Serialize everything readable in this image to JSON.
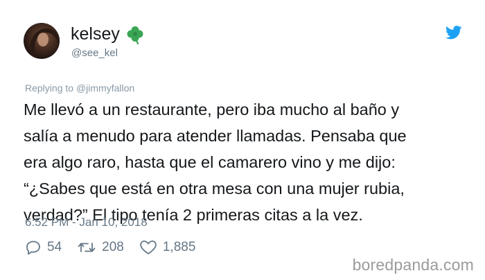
{
  "user": {
    "display_name": "kelsey",
    "handle": "@see_kel"
  },
  "icons": {
    "emoji": "clover-icon",
    "brand": "twitter-bird-icon",
    "reply": "reply-icon",
    "retweet": "retweet-icon",
    "like": "heart-icon"
  },
  "colors": {
    "twitter_blue": "#1da1f2",
    "clover_green": "#3aa655",
    "secondary_text": "#657786"
  },
  "reply": {
    "prefix": "Replying to ",
    "mention": "@jimmyfallon"
  },
  "tweet": {
    "text": "Me llevó a un restaurante, pero iba mucho al baño y\nsalía a menudo para atender llamadas. Pensaba que\nera algo raro, hasta que el camarero vino y me dijo:\n“¿Sabes que está en otra mesa con una mujer rubia,\nverdad?” El tipo tenía 2 primeras citas a la vez.",
    "timestamp": "6:52 PM - Jan 10, 2018"
  },
  "stats": {
    "replies": "54",
    "retweets": "208",
    "likes": "1,885"
  },
  "watermark": "boredpanda.com"
}
